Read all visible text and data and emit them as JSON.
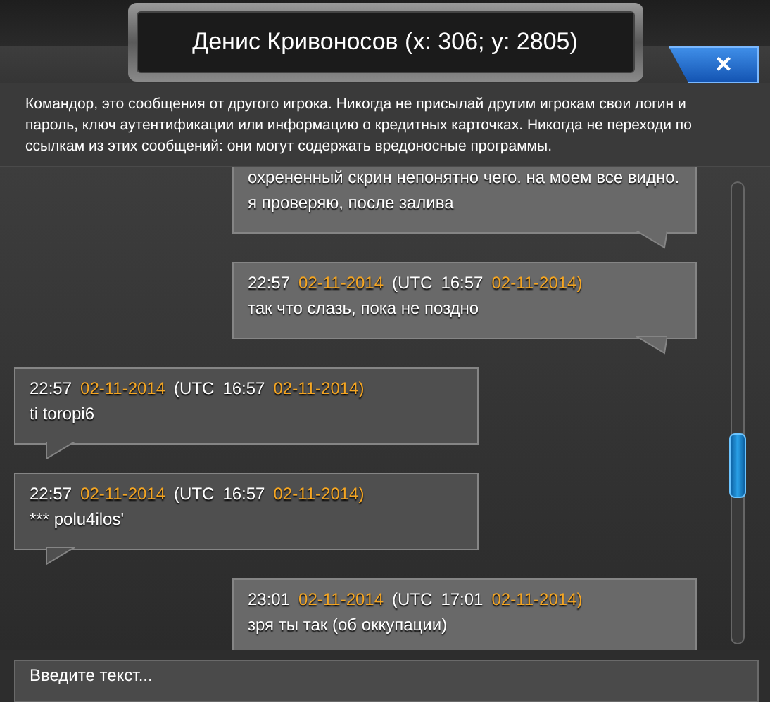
{
  "window": {
    "title": "Денис Кривоносов (x: 306; y: 2805)",
    "close_label": "×"
  },
  "warning": "Командор, это сообщения от другого игрока. Никогда не присылай другим игрокам свои логин и пароль, ключ аутентификации или информацию о кредитных карточках. Никогда не переходи по ссылкам из этих сообщений: они могут содержать вредоносные программы.",
  "messages": [
    {
      "kind": "outgoing",
      "text": "охрененный скрин непонятно чего. на моем все видно. я проверяю, после залива"
    },
    {
      "kind": "outgoing",
      "time": "22:57",
      "date": "02-11-2014",
      "utc_label": "(UTC",
      "utc_time": "16:57",
      "utc_date": "02-11-2014)",
      "text": "так что слазь, пока не поздно"
    },
    {
      "kind": "incoming",
      "time": "22:57",
      "date": "02-11-2014",
      "utc_label": "(UTC",
      "utc_time": "16:57",
      "utc_date": "02-11-2014)",
      "text": "ti toropi6"
    },
    {
      "kind": "incoming",
      "time": "22:57",
      "date": "02-11-2014",
      "utc_label": "(UTC",
      "utc_time": "16:57",
      "utc_date": "02-11-2014)",
      "text": "*** polu4ilos'"
    },
    {
      "kind": "outgoing",
      "time": "23:01",
      "date": "02-11-2014",
      "utc_label": "(UTC",
      "utc_time": "17:01",
      "utc_date": "02-11-2014)",
      "text": "зря ты так (об оккупации)"
    }
  ],
  "input": {
    "placeholder": "Введите текст..."
  }
}
